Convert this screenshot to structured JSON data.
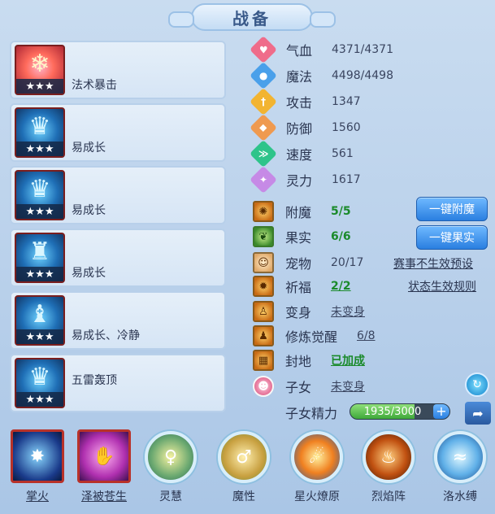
{
  "title": "战备",
  "skills": [
    {
      "name": "法术暴击",
      "stars": "★★★"
    },
    {
      "name": "易成长",
      "stars": "★★★"
    },
    {
      "name": "易成长",
      "stars": "★★★"
    },
    {
      "name": "易成长",
      "stars": "★★★"
    },
    {
      "name": "易成长、冷静",
      "stars": "★★★"
    },
    {
      "name": "五雷轰顶",
      "stars": "★★★"
    }
  ],
  "stats": [
    {
      "label": "气血",
      "value": "4371/4371",
      "icon": "heart-icon",
      "color": "#ef6c8a"
    },
    {
      "label": "魔法",
      "value": "4498/4498",
      "icon": "mana-icon",
      "color": "#4aa0ea"
    },
    {
      "label": "攻击",
      "value": "1347",
      "icon": "attack-icon",
      "color": "#f2b431"
    },
    {
      "label": "防御",
      "value": "1560",
      "icon": "defense-icon",
      "color": "#ef9a50"
    },
    {
      "label": "速度",
      "value": "561",
      "icon": "speed-icon",
      "color": "#2ec48a"
    },
    {
      "label": "灵力",
      "value": "1617",
      "icon": "spirit-icon",
      "color": "#c68ae6"
    }
  ],
  "extras": {
    "enchant": {
      "label": "附魔",
      "value": "5/5"
    },
    "fruit": {
      "label": "果实",
      "value": "6/6"
    },
    "pet": {
      "label": "宠物",
      "value": "20/17"
    },
    "blessing": {
      "label": "祈福",
      "value": "2/2"
    },
    "transform": {
      "label": "变身",
      "value": "未变身"
    },
    "awaken": {
      "label": "修炼觉醒",
      "value": "6/8"
    },
    "fief": {
      "label": "封地",
      "value": "已加成"
    },
    "child": {
      "label": "子女",
      "value": "未变身"
    },
    "child_energy": {
      "label": "子女精力",
      "value": "1935/3000",
      "current": 1935,
      "max": 3000
    }
  },
  "buttons": {
    "enchant_all": "一键附魔",
    "fruit_all": "一键果实",
    "event_preset": "赛事不生效预设",
    "status_rules": "状态生效规则",
    "plus": "+"
  },
  "bottom_skills": [
    {
      "name": "掌火",
      "icon": "palm-fire-icon"
    },
    {
      "name": "泽被苍生",
      "icon": "blessing-hand-icon"
    },
    {
      "name": "灵慧",
      "icon": "wisdom-icon"
    },
    {
      "name": "魔性",
      "icon": "demonic-icon"
    },
    {
      "name": "星火燎原",
      "icon": "prairie-fire-icon"
    },
    {
      "name": "烈焰阵",
      "icon": "flame-array-icon"
    },
    {
      "name": "洛水缚",
      "icon": "water-bind-icon"
    }
  ]
}
